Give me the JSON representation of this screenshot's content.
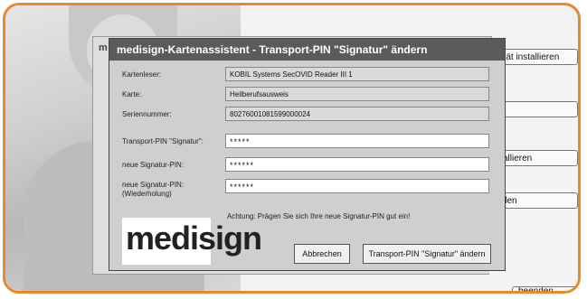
{
  "dialog": {
    "title": "medisign-Kartenassistent - Transport-PIN \"Signatur\" ändern",
    "labels": {
      "kartenleser": "Kartenleser:",
      "karte": "Karte:",
      "seriennummer": "Seriennummer:",
      "transport_pin": "Transport-PIN \"Signatur\":",
      "neue_pin": "neue Signatur-PIN:",
      "neue_pin_repeat_1": "neue Signatur-PIN:",
      "neue_pin_repeat_2": "(Wiederholung)"
    },
    "values": {
      "kartenleser": "KOBIL Systems SecOVID Reader III 1",
      "karte": "Heilberufsausweis",
      "seriennummer": "80276001081599000024",
      "transport_pin": "*****",
      "neue_pin": "******",
      "neue_pin_repeat": "******"
    },
    "warning": "Achtung: Prägen Sie sich Ihre neue Signatur-PIN gut ein!",
    "logo_text": "medisign",
    "buttons": {
      "cancel": "Abbrechen",
      "change": "Transport-PIN \"Signatur\" ändern"
    }
  },
  "background": {
    "side_buttons": [
      "rät installieren",
      "",
      "allieren",
      "llen",
      "beenden"
    ],
    "partial_title_char": "m"
  },
  "colors": {
    "frame": "#e8892a",
    "titlebar": "#5b5b5b",
    "dialog_bg": "#cfcfcf"
  }
}
